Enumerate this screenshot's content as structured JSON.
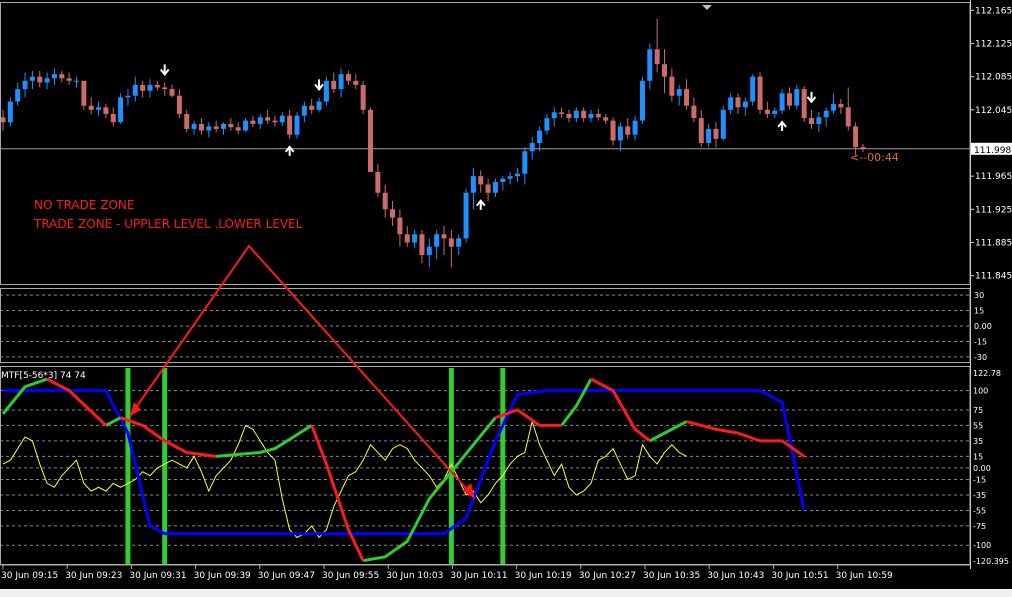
{
  "price_axis": {
    "labels": [
      "112.165",
      "112.125",
      "112.085",
      "112.045",
      "111.998",
      "111.965",
      "111.925",
      "111.885",
      "111.845"
    ],
    "current_price": "111.998",
    "countdown": "<--00:44"
  },
  "osc_mid_axis": {
    "labels": [
      "30",
      "15",
      "0.00",
      "-15",
      "-30"
    ]
  },
  "mtf_axis": {
    "labels": [
      "122.78",
      "100",
      "75",
      "55",
      "35",
      "15",
      "0.00",
      "-15",
      "-35",
      "-55",
      "-75",
      "-100",
      "-120.395"
    ]
  },
  "indicator_label": "MTF[5-56*3] 74 74",
  "annotation": {
    "line1": "NO TRADE ZONE",
    "line2": "TRADE ZONE - UPPLER LEVEL .LOWER LEVEL"
  },
  "time_axis": [
    "30 Jun 09:15",
    "30 Jun 09:23",
    "30 Jun 09:31",
    "30 Jun 09:39",
    "30 Jun 09:47",
    "30 Jun 09:55",
    "30 Jun 10:03",
    "30 Jun 10:11",
    "30 Jun 10:19",
    "30 Jun 10:27",
    "30 Jun 10:35",
    "30 Jun 10:43",
    "30 Jun 10:51",
    "30 Jun 10:59"
  ],
  "colors": {
    "bull": "#1e90ff",
    "bear": "#cd6b6b",
    "grid": "#ffffff",
    "axis_text": "#ffffff",
    "annotation": "#ff1a1a",
    "countdown": "#e07030",
    "signal_bar": "#32cd32",
    "blue_line": "#0000ff",
    "green_line": "#2ecc2e",
    "red_line": "#ff1a1a",
    "yellow_line": "#ffff33"
  },
  "chart_data": {
    "type": "candlestick",
    "price_range": [
      111.835,
      112.175
    ],
    "candles": [
      [
        112.036,
        112.045,
        112.02,
        112.03
      ],
      [
        112.03,
        112.06,
        112.025,
        112.055
      ],
      [
        112.055,
        112.078,
        112.05,
        112.07
      ],
      [
        112.07,
        112.09,
        112.06,
        112.08
      ],
      [
        112.08,
        112.092,
        112.07,
        112.085
      ],
      [
        112.085,
        112.092,
        112.072,
        112.078
      ],
      [
        112.078,
        112.09,
        112.07,
        112.083
      ],
      [
        112.083,
        112.095,
        112.075,
        112.088
      ],
      [
        112.088,
        112.092,
        112.078,
        112.083
      ],
      [
        112.083,
        112.09,
        112.075,
        112.08
      ],
      [
        112.08,
        112.085,
        112.072,
        112.08
      ],
      [
        112.08,
        112.078,
        112.045,
        112.05
      ],
      [
        112.05,
        112.06,
        112.04,
        112.045
      ],
      [
        112.045,
        112.055,
        112.038,
        112.048
      ],
      [
        112.048,
        112.052,
        112.035,
        112.04
      ],
      [
        112.04,
        112.048,
        112.025,
        112.03
      ],
      [
        112.03,
        112.065,
        112.028,
        112.06
      ],
      [
        112.06,
        112.07,
        112.05,
        112.062
      ],
      [
        112.062,
        112.085,
        112.055,
        112.075
      ],
      [
        112.075,
        112.08,
        112.06,
        112.068
      ],
      [
        112.068,
        112.082,
        112.06,
        112.075
      ],
      [
        112.075,
        112.08,
        112.068,
        112.072
      ],
      [
        112.072,
        112.078,
        112.062,
        112.07
      ],
      [
        112.07,
        112.075,
        112.06,
        112.062
      ],
      [
        112.062,
        112.07,
        112.035,
        112.04
      ],
      [
        112.04,
        112.045,
        112.018,
        112.022
      ],
      [
        112.022,
        112.032,
        112.015,
        112.028
      ],
      [
        112.028,
        112.035,
        112.015,
        112.02
      ],
      [
        112.02,
        112.03,
        112.012,
        112.025
      ],
      [
        112.025,
        112.032,
        112.018,
        112.022
      ],
      [
        112.022,
        112.03,
        112.015,
        112.028
      ],
      [
        112.028,
        112.035,
        112.02,
        112.024
      ],
      [
        112.024,
        112.03,
        112.016,
        112.02
      ],
      [
        112.02,
        112.035,
        112.018,
        112.032
      ],
      [
        112.032,
        112.038,
        112.024,
        112.028
      ],
      [
        112.028,
        112.04,
        112.022,
        112.036
      ],
      [
        112.036,
        112.045,
        112.028,
        112.032
      ],
      [
        112.032,
        112.038,
        112.025,
        112.03
      ],
      [
        112.03,
        112.042,
        112.025,
        112.038
      ],
      [
        112.038,
        112.045,
        112.01,
        112.015
      ],
      [
        112.015,
        112.042,
        112.01,
        112.038
      ],
      [
        112.038,
        112.055,
        112.03,
        112.05
      ],
      [
        112.05,
        112.058,
        112.04,
        112.045
      ],
      [
        112.045,
        112.06,
        112.042,
        112.055
      ],
      [
        112.055,
        112.085,
        112.05,
        112.08
      ],
      [
        112.08,
        112.09,
        112.065,
        112.07
      ],
      [
        112.07,
        112.095,
        112.06,
        112.088
      ],
      [
        112.088,
        112.092,
        112.075,
        112.08
      ],
      [
        112.08,
        112.088,
        112.07,
        112.075
      ],
      [
        112.075,
        112.08,
        112.04,
        112.045
      ],
      [
        112.045,
        112.048,
        111.99,
        111.97
      ],
      [
        111.97,
        111.98,
        111.94,
        111.945
      ],
      [
        111.945,
        111.955,
        111.915,
        111.925
      ],
      [
        111.925,
        111.935,
        111.905,
        111.915
      ],
      [
        111.915,
        111.925,
        111.88,
        111.895
      ],
      [
        111.895,
        111.905,
        111.88,
        111.885
      ],
      [
        111.885,
        111.9,
        111.878,
        111.895
      ],
      [
        111.895,
        111.9,
        111.86,
        111.87
      ],
      [
        111.87,
        111.89,
        111.855,
        111.88
      ],
      [
        111.88,
        111.9,
        111.865,
        111.895
      ],
      [
        111.895,
        111.905,
        111.87,
        111.89
      ],
      [
        111.89,
        111.9,
        111.855,
        111.88
      ],
      [
        111.88,
        111.895,
        111.87,
        111.89
      ],
      [
        111.89,
        111.95,
        111.885,
        111.945
      ],
      [
        111.945,
        111.975,
        111.925,
        111.965
      ],
      [
        111.965,
        111.972,
        111.945,
        111.955
      ],
      [
        111.955,
        111.962,
        111.935,
        111.945
      ],
      [
        111.945,
        111.962,
        111.94,
        111.958
      ],
      [
        111.958,
        111.965,
        111.948,
        111.962
      ],
      [
        111.962,
        111.97,
        111.955,
        111.965
      ],
      [
        111.965,
        111.975,
        111.958,
        111.968
      ],
      [
        111.968,
        112.0,
        111.955,
        111.995
      ],
      [
        111.995,
        112.012,
        111.985,
        112.005
      ],
      [
        112.005,
        112.025,
        111.995,
        112.02
      ],
      [
        112.02,
        112.04,
        112.015,
        112.035
      ],
      [
        112.035,
        112.048,
        112.025,
        112.042
      ],
      [
        112.042,
        112.048,
        112.035,
        112.04
      ],
      [
        112.04,
        112.045,
        112.03,
        112.035
      ],
      [
        112.035,
        112.048,
        112.03,
        112.044
      ],
      [
        112.044,
        112.048,
        112.03,
        112.035
      ],
      [
        112.035,
        112.045,
        112.03,
        112.04
      ],
      [
        112.04,
        112.046,
        112.032,
        112.036
      ],
      [
        112.036,
        112.04,
        112.028,
        112.032
      ],
      [
        112.032,
        112.036,
        112.002,
        112.008
      ],
      [
        112.008,
        112.03,
        111.995,
        112.025
      ],
      [
        112.025,
        112.035,
        112.01,
        112.015
      ],
      [
        112.015,
        112.038,
        112.008,
        112.032
      ],
      [
        112.032,
        112.085,
        112.028,
        112.08
      ],
      [
        112.08,
        112.125,
        112.07,
        112.118
      ],
      [
        112.118,
        112.155,
        112.09,
        112.1
      ],
      [
        112.1,
        112.118,
        112.065,
        112.085
      ],
      [
        112.085,
        112.095,
        112.055,
        112.062
      ],
      [
        112.062,
        112.075,
        112.05,
        112.07
      ],
      [
        112.07,
        112.082,
        112.045,
        112.05
      ],
      [
        112.05,
        112.06,
        112.03,
        112.035
      ],
      [
        112.035,
        112.045,
        112.0,
        112.005
      ],
      [
        112.005,
        112.028,
        112.0,
        112.022
      ],
      [
        112.022,
        112.03,
        112.0,
        112.01
      ],
      [
        112.01,
        112.05,
        112.008,
        112.045
      ],
      [
        112.045,
        112.065,
        112.04,
        112.06
      ],
      [
        112.06,
        112.065,
        112.04,
        112.048
      ],
      [
        112.048,
        112.06,
        112.038,
        112.055
      ],
      [
        112.055,
        112.088,
        112.05,
        112.085
      ],
      [
        112.085,
        112.09,
        112.04,
        112.045
      ],
      [
        112.045,
        112.055,
        112.035,
        112.04
      ],
      [
        112.04,
        112.048,
        112.035,
        112.044
      ],
      [
        112.044,
        112.07,
        112.04,
        112.065
      ],
      [
        112.065,
        112.072,
        112.045,
        112.05
      ],
      [
        112.05,
        112.075,
        112.045,
        112.07
      ],
      [
        112.07,
        112.074,
        112.03,
        112.035
      ],
      [
        112.035,
        112.045,
        112.022,
        112.028
      ],
      [
        112.028,
        112.042,
        112.018,
        112.036
      ],
      [
        112.036,
        112.048,
        112.025,
        112.044
      ],
      [
        112.044,
        112.065,
        112.04,
        112.052
      ],
      [
        112.052,
        112.058,
        112.04,
        112.048
      ],
      [
        112.048,
        112.072,
        112.02,
        112.025
      ],
      [
        112.025,
        112.03,
        111.99,
        112.0
      ],
      [
        112.0,
        112.004,
        111.994,
        111.998
      ]
    ],
    "arrows_down": [
      22,
      43,
      110
    ],
    "arrows_up": [
      39,
      65,
      106
    ],
    "mtf": {
      "range": [
        -120.395,
        122.78
      ],
      "blue": [
        [
          0,
          100
        ],
        [
          14,
          100
        ],
        [
          17,
          45
        ],
        [
          20,
          -75
        ],
        [
          22,
          -85
        ],
        [
          60,
          -85
        ],
        [
          63,
          -65
        ],
        [
          67,
          35
        ],
        [
          70,
          95
        ],
        [
          74,
          100
        ],
        [
          103,
          100
        ],
        [
          106,
          85
        ],
        [
          109,
          -55
        ]
      ],
      "green_segments": [
        [
          [
            0,
            70
          ],
          [
            3,
            105
          ],
          [
            6,
            115
          ]
        ],
        [
          [
            14,
            55
          ],
          [
            16,
            65
          ]
        ],
        [
          [
            29,
            15
          ],
          [
            35,
            20
          ],
          [
            37,
            25
          ],
          [
            42,
            55
          ]
        ],
        [
          [
            49,
            -120
          ],
          [
            52,
            -115
          ],
          [
            55,
            -95
          ],
          [
            58,
            -40
          ],
          [
            61,
            -5
          ],
          [
            64,
            30
          ],
          [
            67,
            65
          ]
        ],
        [
          [
            76,
            55
          ],
          [
            78,
            80
          ],
          [
            80,
            115
          ]
        ],
        [
          [
            88,
            35
          ],
          [
            93,
            60
          ]
        ]
      ],
      "red_segments": [
        [
          [
            6,
            115
          ],
          [
            9,
            100
          ],
          [
            14,
            55
          ]
        ],
        [
          [
            16,
            65
          ],
          [
            19,
            55
          ],
          [
            22,
            35
          ],
          [
            25,
            20
          ],
          [
            29,
            15
          ]
        ],
        [
          [
            42,
            55
          ],
          [
            44,
            5
          ],
          [
            47,
            -80
          ],
          [
            49,
            -120
          ]
        ],
        [
          [
            67,
            65
          ],
          [
            70,
            75
          ],
          [
            73,
            55
          ],
          [
            76,
            55
          ]
        ],
        [
          [
            80,
            115
          ],
          [
            83,
            100
          ],
          [
            86,
            50
          ],
          [
            88,
            35
          ]
        ],
        [
          [
            93,
            60
          ],
          [
            97,
            50
          ],
          [
            100,
            45
          ],
          [
            103,
            35
          ],
          [
            106,
            35
          ],
          [
            109,
            15
          ]
        ]
      ],
      "yellow": [
        5,
        10,
        25,
        40,
        35,
        5,
        -20,
        -25,
        -10,
        0,
        10,
        -20,
        -30,
        -25,
        -30,
        -20,
        -25,
        -20,
        -15,
        -5,
        -10,
        0,
        5,
        10,
        5,
        0,
        15,
        -5,
        -30,
        -10,
        0,
        10,
        30,
        55,
        50,
        35,
        20,
        10,
        -40,
        -80,
        -90,
        -85,
        -75,
        -90,
        -80,
        -50,
        -30,
        -10,
        -5,
        10,
        30,
        20,
        10,
        25,
        30,
        25,
        10,
        0,
        -10,
        -25,
        -15,
        5,
        -15,
        -35,
        -30,
        -45,
        -35,
        -20,
        -10,
        5,
        15,
        20,
        60,
        30,
        10,
        -10,
        5,
        -25,
        -35,
        -30,
        -20,
        10,
        15,
        25,
        5,
        -15,
        -10,
        30,
        15,
        5,
        20,
        30,
        20,
        15
      ]
    },
    "signal_bars": [
      17,
      22,
      61,
      68
    ]
  }
}
